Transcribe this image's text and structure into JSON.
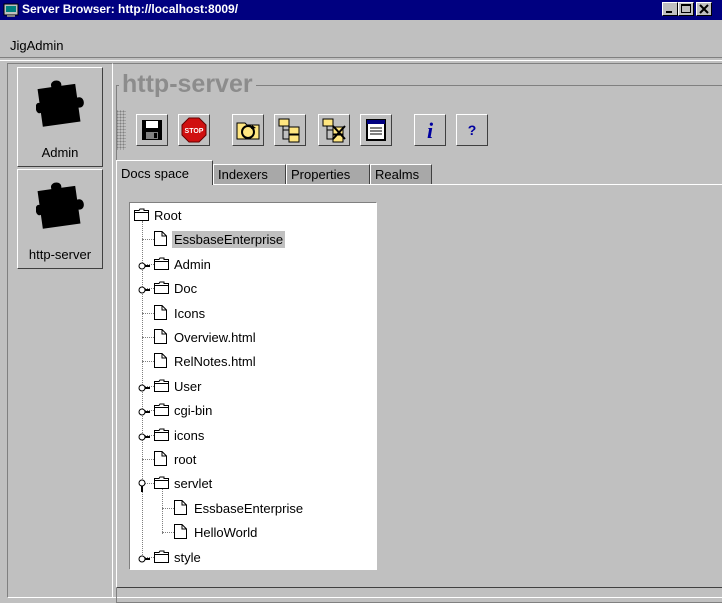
{
  "window": {
    "title": "Server Browser: http://localhost:8009/"
  },
  "menu": {
    "items": [
      "JigAdmin"
    ]
  },
  "nav": {
    "items": [
      {
        "label": "Admin",
        "icon": "puzzle-icon"
      },
      {
        "label": "http-server",
        "icon": "puzzle-icon"
      }
    ]
  },
  "main": {
    "group_title": "http-server",
    "toolbar": [
      {
        "name": "save-button",
        "icon": "floppy-disk-icon"
      },
      {
        "name": "stop-button",
        "icon": "stop-sign-icon",
        "icon_text": "STOP"
      },
      {
        "name": "reindex-button",
        "icon": "refresh-folder-icon"
      },
      {
        "name": "tree-add-button",
        "icon": "folder-tree-icon"
      },
      {
        "name": "tree-delete-button",
        "icon": "folder-tree-delete-icon"
      },
      {
        "name": "properties-button",
        "icon": "document-list-icon"
      },
      {
        "name": "info-button",
        "icon": "info-icon",
        "icon_text": "i"
      },
      {
        "name": "help-button",
        "icon": "help-icon",
        "icon_text": "?"
      }
    ],
    "tabs": [
      {
        "label": "Docs space",
        "active": true
      },
      {
        "label": "Indexers",
        "active": false
      },
      {
        "label": "Properties",
        "active": false
      },
      {
        "label": "Realms",
        "active": false
      }
    ]
  },
  "tree": {
    "nodes": [
      {
        "label": "Root",
        "type": "folder",
        "level": 0
      },
      {
        "label": "EssbaseEnterprise",
        "type": "file",
        "level": 1,
        "selected": true
      },
      {
        "label": "Admin",
        "type": "folder",
        "level": 1,
        "toggle": "collapsed"
      },
      {
        "label": "Doc",
        "type": "folder",
        "level": 1,
        "toggle": "collapsed"
      },
      {
        "label": "Icons",
        "type": "file",
        "level": 1
      },
      {
        "label": "Overview.html",
        "type": "file",
        "level": 1
      },
      {
        "label": "RelNotes.html",
        "type": "file",
        "level": 1
      },
      {
        "label": "User",
        "type": "folder",
        "level": 1,
        "toggle": "collapsed"
      },
      {
        "label": "cgi-bin",
        "type": "folder",
        "level": 1,
        "toggle": "collapsed"
      },
      {
        "label": "icons",
        "type": "folder",
        "level": 1,
        "toggle": "collapsed"
      },
      {
        "label": "root",
        "type": "file",
        "level": 1
      },
      {
        "label": "servlet",
        "type": "folder",
        "level": 1,
        "toggle": "expanded"
      },
      {
        "label": "EssbaseEnterprise",
        "type": "file",
        "level": 2
      },
      {
        "label": "HelloWorld",
        "type": "file",
        "level": 2
      },
      {
        "label": "style",
        "type": "folder",
        "level": 1,
        "toggle": "collapsed"
      }
    ]
  },
  "colors": {
    "titlebar": "#000080",
    "window": "#c0c0c0",
    "selection": "#c0c0c0",
    "group_title": "#8c8c8c"
  }
}
